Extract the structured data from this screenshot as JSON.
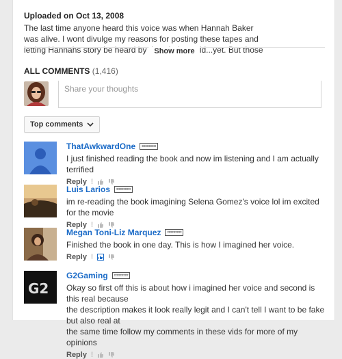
{
  "description": {
    "uploaded": "Uploaded on Oct 13, 2008",
    "lines": [
      "The last time anyone heard this voice was when Hannah Baker",
      "was alive. I wont divulge my reasons for posting these tapes and",
      "letting Hannahs story be heard by the whole world...yet. But those"
    ],
    "show_more": "Show more"
  },
  "comments_header": {
    "label": "ALL COMMENTS",
    "count": "(1,416)"
  },
  "share": {
    "placeholder": "Share your thoughts"
  },
  "sort": {
    "label": "Top comments"
  },
  "comments": [
    {
      "author": "ThatAwkwardOne",
      "badge": "⌗⌗⌗⌗⌗⌗",
      "lines": [
        "I just finished reading the book and now im listening and I am actually terrified"
      ],
      "reply": "Reply",
      "avatar_color": "#5a8fe0"
    },
    {
      "author": "Luis Larios",
      "badge": "⌗⌗⌗⌗⌗⌗",
      "lines": [
        "im re-reading the book imagining Selena Gomez's voice lol im excited for the movie"
      ],
      "reply": "Reply",
      "avatar_color": "#6b4a2a"
    },
    {
      "author": "Megan Toni-Liz Marquez",
      "badge": "⌗⌗⌗⌗⌗⌗",
      "lines": [
        "Finished the book in one day. This is how I imagined her voice."
      ],
      "reply": "Reply",
      "avatar_color": "#7a5a3a"
    },
    {
      "author": "G2Gaming",
      "badge": "⌗⌗⌗⌗⌗⌗",
      "lines": [
        "Okay so first off this is about how i imagined her voice and second is this real because",
        "the description makes it look really legit and I can't tell I want to be fake but also real at",
        "the same time follow my comments in these vids for more of my opinions"
      ],
      "reply": "Reply",
      "avatar_logo": "G2",
      "avatar_color": "#111111"
    }
  ],
  "colors": {
    "link": "#1b6bc7",
    "background": "#ebebeb",
    "panel": "#ffffff"
  }
}
